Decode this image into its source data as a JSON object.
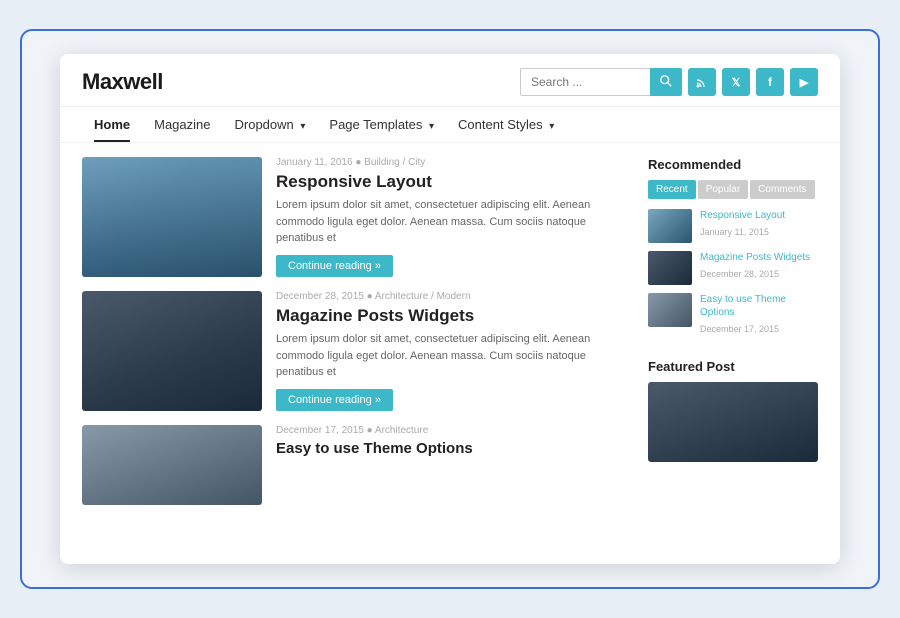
{
  "site": {
    "title": "Maxwell",
    "search_placeholder": "Search ...",
    "search_btn_icon": "🔍",
    "social": [
      {
        "name": "rss",
        "label": "RSS"
      },
      {
        "name": "twitter",
        "label": "T"
      },
      {
        "name": "facebook",
        "label": "f"
      },
      {
        "name": "youtube",
        "label": "▶"
      }
    ]
  },
  "nav": {
    "items": [
      {
        "label": "Home",
        "active": true,
        "has_dropdown": false
      },
      {
        "label": "Magazine",
        "active": false,
        "has_dropdown": false
      },
      {
        "label": "Dropdown",
        "active": false,
        "has_dropdown": true
      },
      {
        "label": "Page Templates",
        "active": false,
        "has_dropdown": true
      },
      {
        "label": "Content Styles",
        "active": false,
        "has_dropdown": true
      }
    ]
  },
  "posts": [
    {
      "date": "January 11, 2016",
      "category": "Building / City",
      "title": "Responsive Layout",
      "excerpt": "Lorem ipsum dolor sit amet, consectetuer adipiscing elit. Aenean commodo ligula eget dolor. Aenean massa. Cum sociis natoque penatibus et",
      "read_more": "Continue reading »"
    },
    {
      "date": "December 28, 2015",
      "category": "Architecture / Modern",
      "title": "Magazine Posts Widgets",
      "excerpt": "Lorem ipsum dolor sit amet, consectetuer adipiscing elit. Aenean commodo ligula eget dolor. Aenean massa. Cum sociis natoque penatibus et",
      "read_more": "Continue reading »"
    },
    {
      "date": "December 17, 2015",
      "category": "Architecture",
      "title": "Easy to use Theme Options",
      "excerpt": "",
      "read_more": ""
    }
  ],
  "sidebar": {
    "recommended_title": "Recommended",
    "tabs": [
      "Recent",
      "Popular",
      "Comments"
    ],
    "rec_items": [
      {
        "title": "Responsive Layout",
        "date": "January 11, 2015"
      },
      {
        "title": "Magazine Posts Widgets",
        "date": "December 28, 2015"
      },
      {
        "title": "Easy to use Theme Options",
        "date": "December 17, 2015"
      }
    ],
    "featured_title": "Featured Post"
  }
}
